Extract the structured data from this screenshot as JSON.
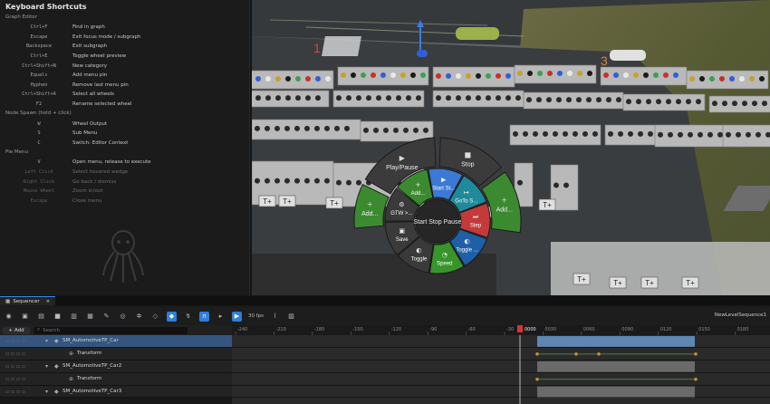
{
  "shortcuts": {
    "title": "Keyboard Shortcuts",
    "sections": [
      {
        "name": "Graph Editor",
        "items": [
          {
            "key": "Ctrl+F",
            "desc": "Find in graph",
            "dim": false
          },
          {
            "key": "Escape",
            "desc": "Exit focus mode / subgraph",
            "dim": false
          },
          {
            "key": "Backspace",
            "desc": "Exit subgraph",
            "dim": false
          },
          {
            "key": "Ctrl+E",
            "desc": "Toggle wheel preview",
            "dim": false
          },
          {
            "key": "Ctrl+Shift+N",
            "desc": "New category",
            "dim": false
          },
          {
            "key": "Equals",
            "desc": "Add menu pin",
            "dim": false
          },
          {
            "key": "Hyphen",
            "desc": "Remove last menu pin",
            "dim": false
          },
          {
            "key": "Ctrl+Shift+A",
            "desc": "Select all wheels",
            "dim": false
          },
          {
            "key": "F2",
            "desc": "Rename selected wheel",
            "dim": false
          }
        ]
      },
      {
        "name": "Node Spawn (hold + click)",
        "items": [
          {
            "key": "W",
            "desc": "Wheel Output",
            "dim": false
          },
          {
            "key": "S",
            "desc": "Sub Menu",
            "dim": false
          },
          {
            "key": "C",
            "desc": "Switch: Editor Context",
            "dim": false
          }
        ]
      },
      {
        "name": "Pie Menu",
        "items": [
          {
            "key": "V",
            "desc": "Open menu, release to execute",
            "dim": false
          },
          {
            "key": "Left Click",
            "desc": "Select hovered wedge",
            "dim": true
          },
          {
            "key": "Right Click",
            "desc": "Go back / dismiss",
            "dim": true
          },
          {
            "key": "Mouse Wheel",
            "desc": "Zoom in/out",
            "dim": true
          },
          {
            "key": "Escape",
            "desc": "Close menu",
            "dim": true
          }
        ]
      }
    ]
  },
  "viewport": {
    "marker_left": "1",
    "marker_right": "3",
    "pie": {
      "outer": [
        {
          "label": "Play/Pause",
          "icon": "play-icon",
          "color": "#3b3b3b"
        },
        {
          "label": "Stop",
          "icon": "stop-icon",
          "color": "#3b3b3b"
        },
        {
          "label": "Add...",
          "icon": "add-icon",
          "color": "#3c8a30"
        },
        {
          "label": "Add...",
          "icon": "add-icon",
          "color": "#3c8a30"
        }
      ],
      "inner": [
        {
          "label": "Start St...",
          "icon": "start-icon",
          "color": "#3b79d4"
        },
        {
          "label": "GoTo S...",
          "icon": "goto-icon",
          "color": "#1f8a9a"
        },
        {
          "label": "Step",
          "icon": "step-icon",
          "color": "#c23a3a"
        },
        {
          "label": "Toggle ...",
          "icon": "toggle-icon",
          "color": "#1e5fa8"
        },
        {
          "label": "Speed",
          "icon": "speed-icon",
          "color": "#37952b"
        },
        {
          "label": "Toggle",
          "icon": "toggle-icon",
          "color": "#3a3a3a"
        },
        {
          "label": "Save",
          "icon": "save-icon",
          "color": "#3a3a3a"
        },
        {
          "label": "GTW >...",
          "icon": "gtw-icon",
          "color": "#3a3a3a"
        },
        {
          "label": "Add...",
          "icon": "add-icon",
          "color": "#3c8a30"
        }
      ],
      "center": "Start Stop Pause",
      "tplus": "T+"
    }
  },
  "sequencer": {
    "tab_label": "Sequencer",
    "fps": "30 fps",
    "sequence_name": "NewLevelSequence1",
    "add_label": "Add",
    "search_placeholder": "Search",
    "playhead": "0000",
    "ticks": [
      "-240",
      "-210",
      "-180",
      "-150",
      "-120",
      "-90",
      "-60",
      "-30",
      "0030",
      "0060",
      "0090",
      "0120",
      "0150",
      "0180"
    ],
    "tracks": [
      {
        "label": "SM_AutomotiveTP_Car",
        "indent": 0,
        "selected": true
      },
      {
        "label": "Transform",
        "indent": 1,
        "selected": false
      },
      {
        "label": "SM_AutomotiveTP_Car2",
        "indent": 0,
        "selected": false
      },
      {
        "label": "Transform",
        "indent": 1,
        "selected": false
      },
      {
        "label": "SM_AutomotiveTP_Car3",
        "indent": 0,
        "selected": false
      }
    ]
  }
}
